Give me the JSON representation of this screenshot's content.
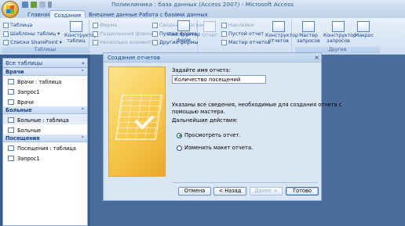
{
  "window": {
    "title": "Поликлиника : база данных (Access 2007) - Microsoft Access"
  },
  "tabs": [
    "Главная",
    "Создание",
    "Внешние данные",
    "Работа с базами данных"
  ],
  "active_tab": "Создание",
  "ribbon": {
    "tables": {
      "label": "Таблицы",
      "table": "Таблица",
      "templates": "Шаблоны таблиц",
      "sharepoint": "Списки SharePoint",
      "constructor": "Конструктор таблиц"
    },
    "forms": {
      "form": "Форма",
      "split_form": "Разделенная форма",
      "multiple_items": "Несколько элементов",
      "pivot_chart": "Сводная диаграмма",
      "blank_form": "Пустая форма",
      "more_forms": "Другие формы",
      "constructor": "Конструктор форм"
    },
    "reports": {
      "report": "Отчет",
      "labels": "Наклейки",
      "blank_report": "Пустой отчет",
      "report_wizard": "Мастер отчетов",
      "constructor": "Конструктор отчетов"
    },
    "other": {
      "label": "Другие",
      "query_wizard": "Мастер запросов",
      "query_constructor": "Конструктор запросов",
      "macro": "Макрос"
    }
  },
  "nav": {
    "header": "Все таблицы",
    "sections": [
      {
        "title": "Врачи",
        "items": [
          "Врачи : таблица",
          "Запрос1",
          "Врачи"
        ]
      },
      {
        "title": "Больные",
        "items": [
          "Больные : таблица",
          "Больные"
        ]
      },
      {
        "title": "Посещения",
        "items": [
          "Посещения : таблица",
          "Запрос1"
        ]
      }
    ]
  },
  "dialog": {
    "title": "Создание отчетов",
    "name_label": "Задайте имя отчета:",
    "name_value": "Количество посещений",
    "info_text_1": "Указаны все сведения, необходимые для создания отчета с",
    "info_text_2": "помощью мастера.",
    "next_actions": "Дальнейшие действия:",
    "option_preview": "Просмотреть отчет.",
    "option_modify": "Изменить макет отчета.",
    "selected_option": "preview",
    "buttons": {
      "cancel": "Отмена",
      "back": "< Назад",
      "next": "Далее >",
      "finish": "Готово"
    }
  }
}
